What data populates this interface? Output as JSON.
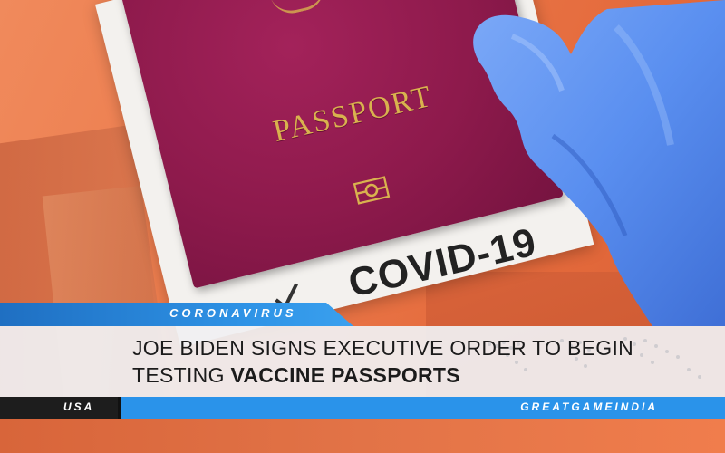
{
  "article": {
    "category": "CORONAVIRUS",
    "headline_line1": "JOE BIDEN SIGNS EXECUTIVE ORDER TO BEGIN",
    "headline_line2_prefix": "TESTING ",
    "headline_line2_bold": "VACCINE PASSPORTS",
    "region": "USA",
    "brand": "GREATGAMEINDIA"
  },
  "photo": {
    "passport_text": "PASSPORT",
    "label_text": "COVID-19"
  },
  "colors": {
    "accent_blue": "#2a93ea",
    "dark": "#1d1d1d",
    "background_orange": "#e8764a",
    "passport_maroon": "#8e1a4c",
    "gold": "#d9b24e",
    "glove_blue": "#5a8ff0"
  }
}
